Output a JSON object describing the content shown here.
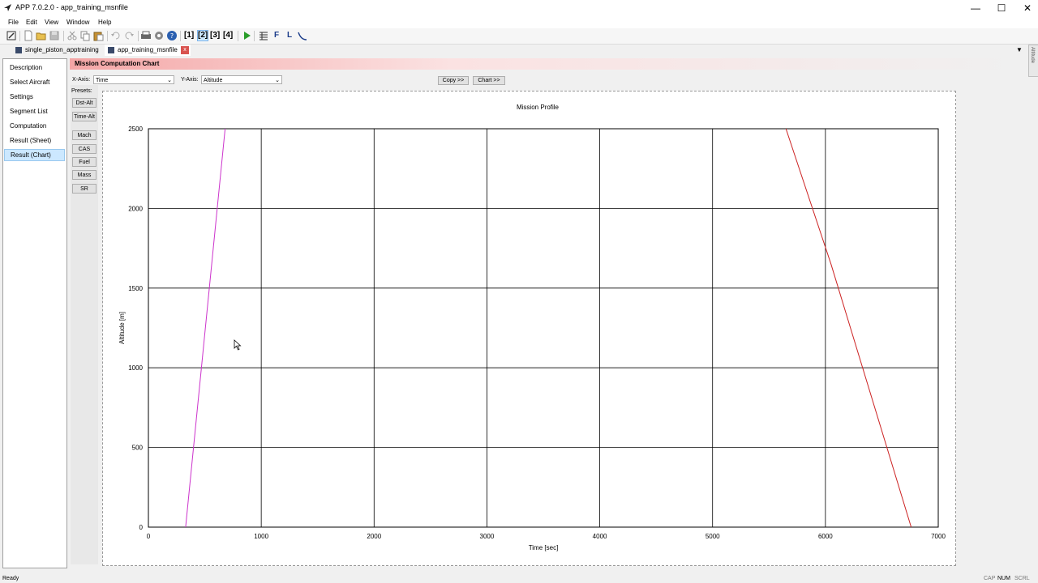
{
  "window": {
    "title": "APP 7.0.2.0 - app_training_msnfile",
    "minimize": "—",
    "maximize": "☐",
    "close": "✕"
  },
  "menu": [
    "File",
    "Edit",
    "View",
    "Window",
    "Help"
  ],
  "toolbar": {
    "icons": [
      "edit-icon",
      "new-icon",
      "open-icon",
      "save-icon",
      "cut-icon",
      "copy-icon",
      "paste-icon",
      "undo-icon",
      "redo-icon",
      "print-icon",
      "settings-icon",
      "help-icon",
      "view1-icon",
      "view2-icon",
      "view3-icon",
      "view4-icon",
      "run-icon",
      "table-icon",
      "f-icon",
      "l-icon",
      "curve-icon"
    ],
    "view1": "[1]",
    "view2": "[2]",
    "view3": "[3]",
    "view4": "[4]",
    "f": "F",
    "l": "L"
  },
  "tabs": [
    {
      "label": "single_piston_apptraining"
    },
    {
      "label": "app_training_msnfile"
    }
  ],
  "tab_close": "x",
  "tabs_dropdown": "▼",
  "sidebar": {
    "items": [
      {
        "label": "Description"
      },
      {
        "label": "Select Aircraft"
      },
      {
        "label": "Settings"
      },
      {
        "label": "Segment List"
      },
      {
        "label": "Computation"
      },
      {
        "label": "Result (Sheet)"
      },
      {
        "label": "Result (Chart)"
      }
    ],
    "selected": "Result (Chart)"
  },
  "panel": {
    "title": "Mission Computation Chart",
    "x_axis_label": "X-Axis:",
    "x_axis_value": "Time",
    "y_axis_label": "Y-Axis:",
    "y_axis_value": "Altitude",
    "copy_button": "Copy >>",
    "chart_button": "Chart >>",
    "presets_label": "Presets:",
    "presets": [
      "Dst-Alt",
      "Time-Alt",
      "Mach",
      "CAS",
      "Fuel",
      "Mass",
      "SR"
    ]
  },
  "right_strip_text": "Altitude",
  "status": {
    "text": "Ready",
    "indicators": [
      "CAP",
      "NUM",
      "SCRL"
    ]
  },
  "colors": {
    "climb": "#cc33cc",
    "descent": "#cc2222",
    "selection": "#cce8ff",
    "header": "#f4a6a6"
  },
  "chart_data": {
    "type": "line",
    "title": "Mission Profile",
    "xlabel": "Time [sec]",
    "ylabel": "Altitude [m]",
    "xlim": [
      0,
      7000
    ],
    "ylim": [
      0,
      2500
    ],
    "xticks": [
      0,
      1000,
      2000,
      3000,
      4000,
      5000,
      6000,
      7000
    ],
    "yticks": [
      0,
      500,
      1000,
      1500,
      2000,
      2500
    ],
    "grid": true,
    "series": [
      {
        "color": "#cc33cc",
        "x": [
          330,
          680
        ],
        "y": [
          0,
          2500
        ]
      },
      {
        "color": "#cc2222",
        "x": [
          5650,
          6050,
          6760
        ],
        "y": [
          2500,
          1650,
          0
        ]
      }
    ]
  }
}
